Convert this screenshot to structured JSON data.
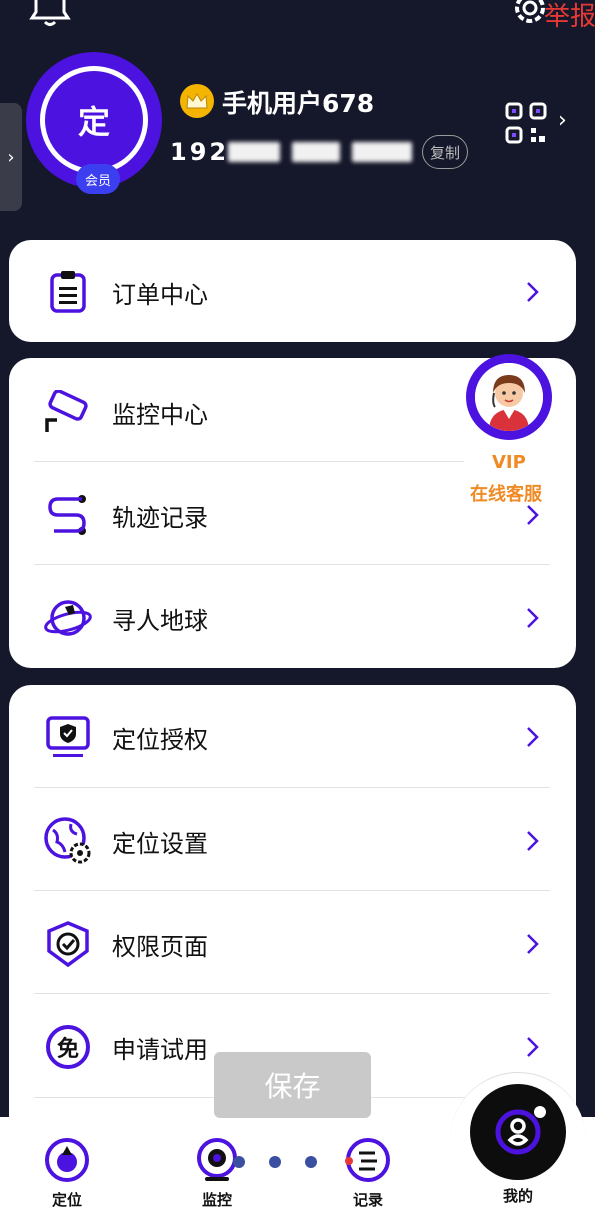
{
  "header": {
    "report_label": "举报",
    "side_tab_icon": "chevron-right-icon"
  },
  "profile": {
    "avatar_text": "定",
    "member_badge": "会员",
    "username": "手机用户678",
    "phone_visible": "192",
    "copy_label": "复制",
    "qr_chevron": "›"
  },
  "menu": {
    "group1": [
      {
        "label": "订单中心",
        "icon": "clipboard-icon"
      }
    ],
    "group2": [
      {
        "label": "监控中心",
        "icon": "camera-icon"
      },
      {
        "label": "轨迹记录",
        "icon": "route-icon"
      },
      {
        "label": "寻人地球",
        "icon": "globe-icon"
      }
    ],
    "group3": [
      {
        "label": "定位授权",
        "icon": "shield-monitor-icon"
      },
      {
        "label": "定位设置",
        "icon": "globe-gear-icon"
      },
      {
        "label": "权限页面",
        "icon": "badge-check-icon"
      },
      {
        "label": "申请试用",
        "icon": "free-icon"
      }
    ],
    "free_glyph": "免"
  },
  "service": {
    "vip": "VIP",
    "label": "在线客服"
  },
  "save_label": "保存",
  "tabs": [
    {
      "label": "定位",
      "icon": "location-icon"
    },
    {
      "label": "监控",
      "icon": "webcam-icon"
    },
    {
      "label": "记录",
      "icon": "route-icon"
    },
    {
      "label": "我的",
      "icon": "user-icon"
    }
  ],
  "colors": {
    "background": "#15172a",
    "accent": "#4b12e0",
    "service_text": "#f08a24",
    "report": "#e53935"
  }
}
